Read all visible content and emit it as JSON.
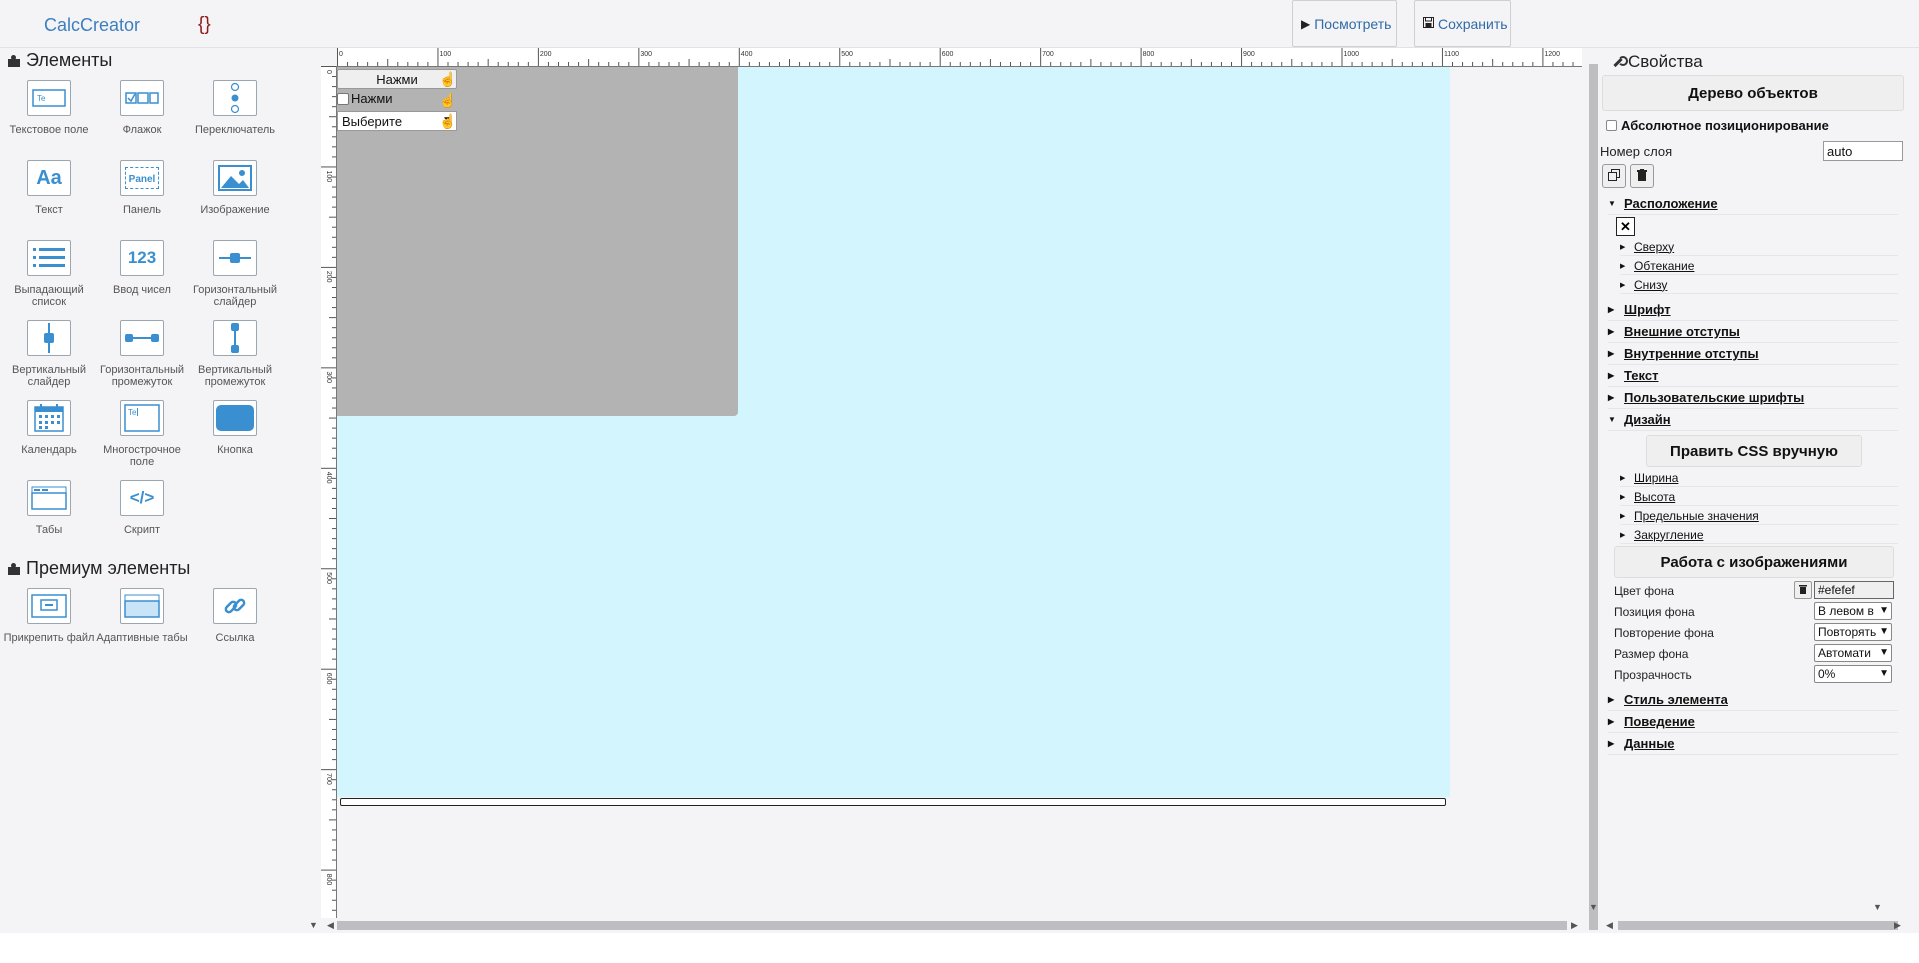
{
  "header": {
    "logo": "CalcCreator",
    "braces": "{}",
    "preview_label": "Посмотреть",
    "save_label": "Сохранить"
  },
  "left": {
    "elements_title": "Элементы",
    "premium_title": "Премиум элементы",
    "tools": [
      {
        "label": "Текстовое поле",
        "icon": "text-field-icon"
      },
      {
        "label": "Флажок",
        "icon": "checkbox-icon"
      },
      {
        "label": "Переключатель",
        "icon": "radio-icon"
      },
      {
        "label": "Текст",
        "icon": "text-icon",
        "glyph": "Aa"
      },
      {
        "label": "Панель",
        "icon": "panel-icon",
        "glyph": "Panel"
      },
      {
        "label": "Изображение",
        "icon": "image-icon"
      },
      {
        "label": "Выпадающий список",
        "icon": "dropdown-icon"
      },
      {
        "label": "Ввод чисел",
        "icon": "number-input-icon",
        "glyph": "123"
      },
      {
        "label": "Горизонтальный слайдер",
        "icon": "horizontal-slider-icon"
      },
      {
        "label": "Вертикальный слайдер",
        "icon": "vertical-slider-icon"
      },
      {
        "label": "Горизонтальный промежуток",
        "icon": "horizontal-spacer-icon"
      },
      {
        "label": "Вертикальный промежуток",
        "icon": "vertical-spacer-icon"
      },
      {
        "label": "Календарь",
        "icon": "calendar-icon"
      },
      {
        "label": "Многострочное поле",
        "icon": "textarea-icon"
      },
      {
        "label": "Кнопка",
        "icon": "button-icon"
      },
      {
        "label": "Табы",
        "icon": "tabs-icon"
      },
      {
        "label": "Скрипт",
        "icon": "script-icon",
        "glyph": "</>"
      }
    ],
    "premium_tools": [
      {
        "label": "Прикрепить файл",
        "icon": "attach-file-icon"
      },
      {
        "label": "Адаптивные табы",
        "icon": "adaptive-tabs-icon"
      },
      {
        "label": "Ссылка",
        "icon": "link-icon"
      }
    ]
  },
  "canvas": {
    "ruler_top_labels": [
      "0",
      "100",
      "200",
      "300",
      "400",
      "500",
      "600",
      "700",
      "800",
      "900",
      "1000",
      "1100",
      "1200"
    ],
    "ruler_left_labels": [
      "0",
      "100",
      "200",
      "300",
      "400",
      "500",
      "600",
      "700",
      "800"
    ],
    "stage_color": "#d3f5fd",
    "panel_color": "#b3b3b3",
    "button_text": "Нажми",
    "checkbox_text": "Нажми",
    "select_text": "Выберите"
  },
  "right": {
    "title": "Свойства",
    "tree_button": "Дерево объектов",
    "absolute_label": "Абсолютное позиционирование",
    "layer_label": "Номер слоя",
    "layer_value": "auto",
    "sections": {
      "location": "Расположение",
      "top": "Сверху",
      "wrap": "Обтекание",
      "bottom": "Снизу",
      "font": "Шрифт",
      "outer": "Внешние отступы",
      "inner": "Внутренние отступы",
      "text": "Текст",
      "custom_fonts": "Пользовательские шрифты",
      "design": "Дизайн",
      "css_button": "Править CSS вручную",
      "width": "Ширина",
      "height": "Высота",
      "limits": "Предельные значения",
      "rounding": "Закругление",
      "images_button": "Работа с изображениями",
      "element_style": "Стиль элемента",
      "behavior": "Поведение",
      "data": "Данные"
    },
    "props": {
      "bg_color_label": "Цвет фона",
      "bg_color_value": "#efefef",
      "bg_position_label": "Позиция фона",
      "bg_position_value": "В левом в",
      "bg_repeat_label": "Повторение фона",
      "bg_repeat_value": "Повторять",
      "bg_size_label": "Размер фона",
      "bg_size_value": "Автомати",
      "opacity_label": "Прозрачность",
      "opacity_value": "0%"
    }
  }
}
